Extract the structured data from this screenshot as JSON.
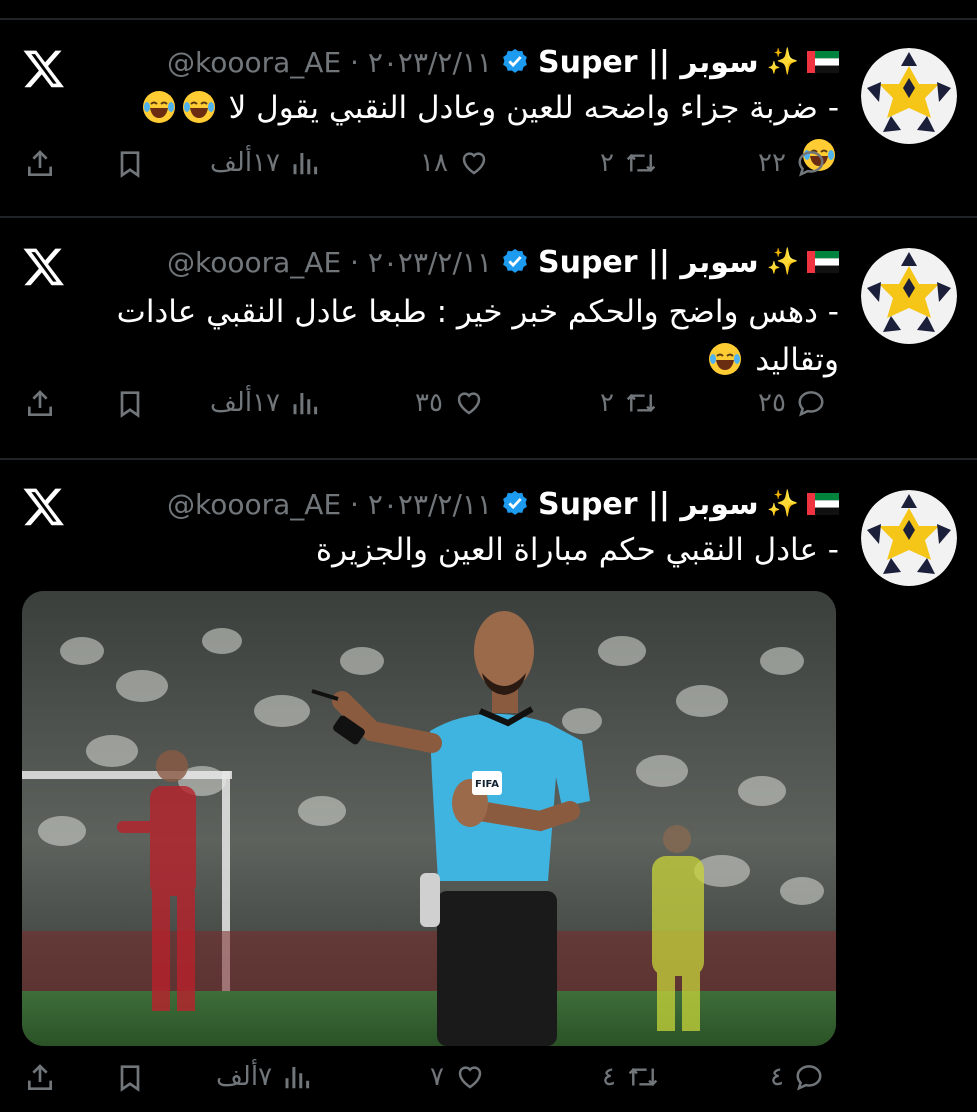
{
  "tweets": [
    {
      "account_name": "Super || سوبر",
      "handle_date": "@kooora_AE · ٢٠٢٣/٢/١١",
      "text": "- ضربة جزاء واضحه للعين وعادل النقبي يقول لا",
      "emoji_count": 3,
      "replies": "٢٢",
      "reposts": "٢",
      "likes": "١٨",
      "views": "١٧ألف"
    },
    {
      "account_name": "Super || سوبر",
      "handle_date": "@kooora_AE · ٢٠٢٣/٢/١١",
      "text": "- دهس واضح والحكم خبر خير : طبعا عادل النقبي عادات وتقاليد",
      "emoji_count": 1,
      "replies": "٢٥",
      "reposts": "٢",
      "likes": "٣٥",
      "views": "١٧ألف"
    },
    {
      "account_name": "Super || سوبر",
      "handle_date": "@kooora_AE · ٢٠٢٣/٢/١١",
      "text": "- عادل النقبي حكم مباراة العين والجزيرة",
      "emoji_count": 0,
      "replies": "٤",
      "reposts": "٤",
      "likes": "٧",
      "views": "٧ألف",
      "media": {
        "badge": "FIFA"
      }
    }
  ],
  "colors": {
    "background": "#000000",
    "text": "#e7e9ea",
    "muted": "#71767b",
    "verified": "#1d9bf0",
    "separator": "#202327"
  },
  "icons": [
    "x-logo-icon",
    "verified-icon",
    "uae-flag-icon",
    "sparkles-icon",
    "laughing-emoji-icon",
    "reply-icon",
    "repost-icon",
    "like-icon",
    "views-icon",
    "bookmark-icon",
    "share-icon"
  ]
}
